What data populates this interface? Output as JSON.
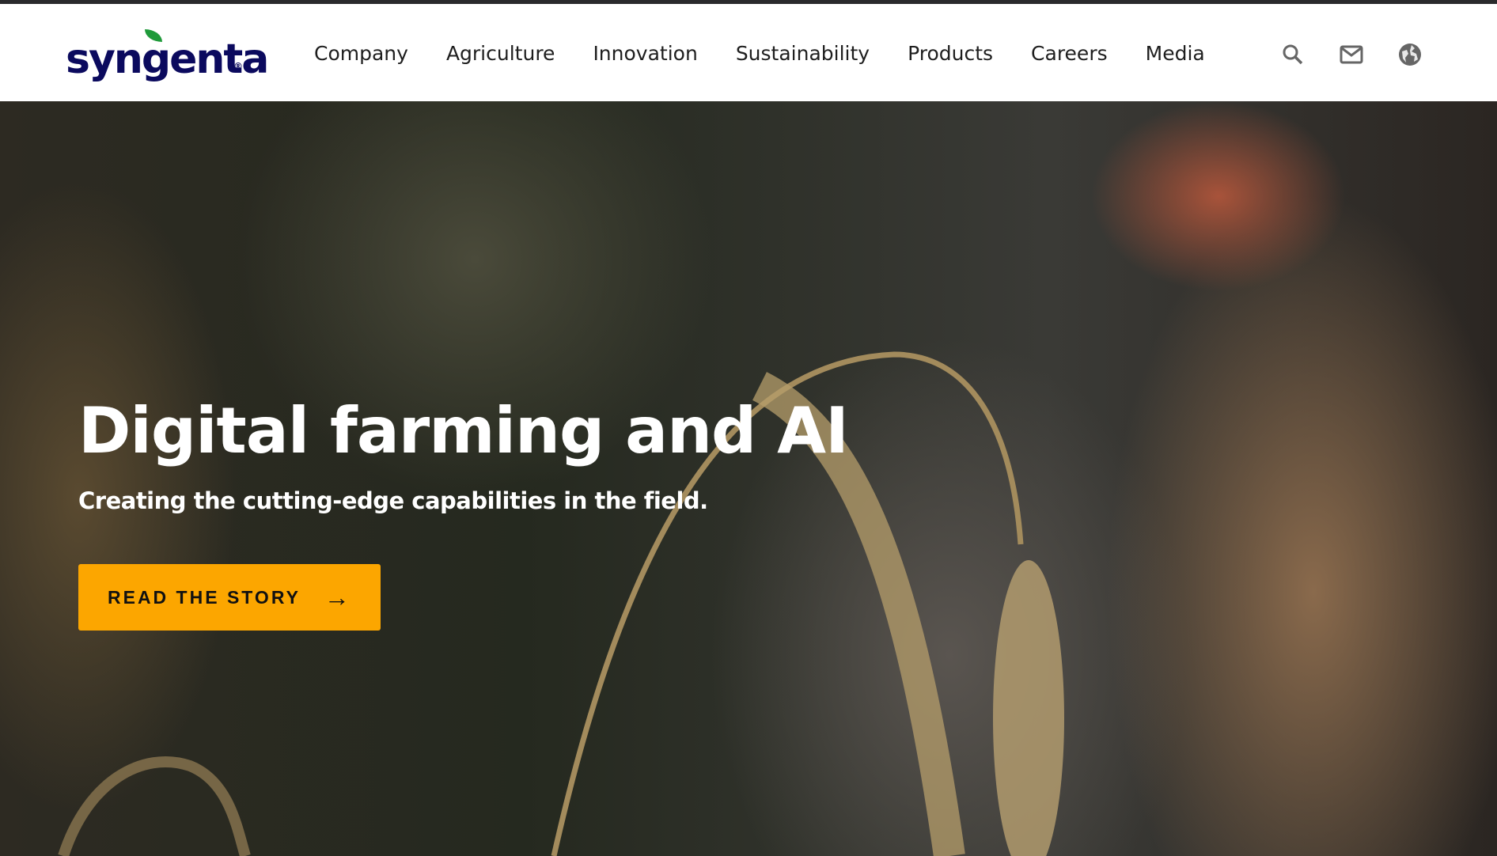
{
  "brand": {
    "name": "syngenta",
    "registered": "®"
  },
  "nav": [
    "Company",
    "Agriculture",
    "Innovation",
    "Sustainability",
    "Products",
    "Careers",
    "Media"
  ],
  "icons": [
    "search-icon",
    "mail-icon",
    "globe-icon"
  ],
  "hero": {
    "title": "Digital farming and AI",
    "subtitle": "Creating the cutting-edge capabilities in the field.",
    "cta": "READ THE STORY"
  },
  "colors": {
    "brand_blue": "#0b0a5e",
    "leaf_green": "#1f9a3a",
    "cta": "#fca600"
  }
}
